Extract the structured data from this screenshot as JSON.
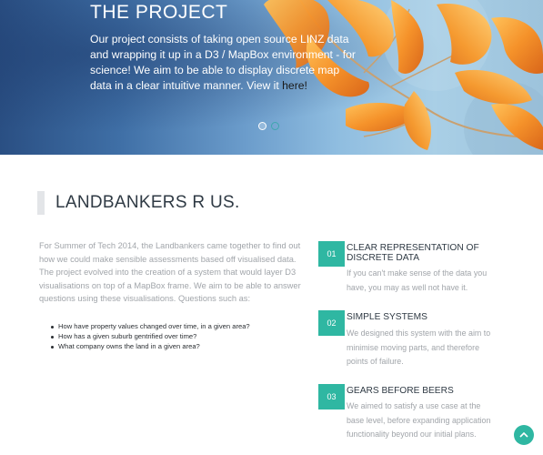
{
  "hero": {
    "title": "THE PROJECT",
    "text": "Our project consists of taking open source LINZ data and wrapping it up in a D3 / MapBox environment - for science! We aim to be able to display discrete map data in a clear intuitive manner. View it ",
    "link_text": "here!",
    "slider": {
      "slides": 2,
      "active": 1
    }
  },
  "section": {
    "title": "LANDBANKERS R US.",
    "intro": "For Summer of Tech 2014, the Landbankers came together to find out how we could make sensible assessments based off visualised data. The project evolved into the creation of a system that would layer D3 visualisations on top of a MapBox frame. We aim to be able to answer questions using these visualisations. Questions such as:",
    "questions": [
      "How have property values changed over time, in a given area?",
      "How has a given suburb gentrified over time?",
      "What company owns the land in a given area?"
    ]
  },
  "features": [
    {
      "num": "01",
      "title": "CLEAR REPRESENTATION OF DISCRETE DATA",
      "text": "If you can't make sense of the data you have, you may as well not have it."
    },
    {
      "num": "02",
      "title": "SIMPLE SYSTEMS",
      "text": "We designed this system with the aim to minimise moving parts, and therefore points of failure."
    },
    {
      "num": "03",
      "title": "GEARS BEFORE BEERS",
      "text": "We aimed to satisfy a use case at the base level, before expanding application functionality beyond our initial plans."
    }
  ],
  "colors": {
    "accent": "#2fb7a2",
    "heading": "#2f3a44",
    "muted": "#a1a5aa"
  },
  "icons": {
    "back_to_top": "chevron-up-icon"
  }
}
